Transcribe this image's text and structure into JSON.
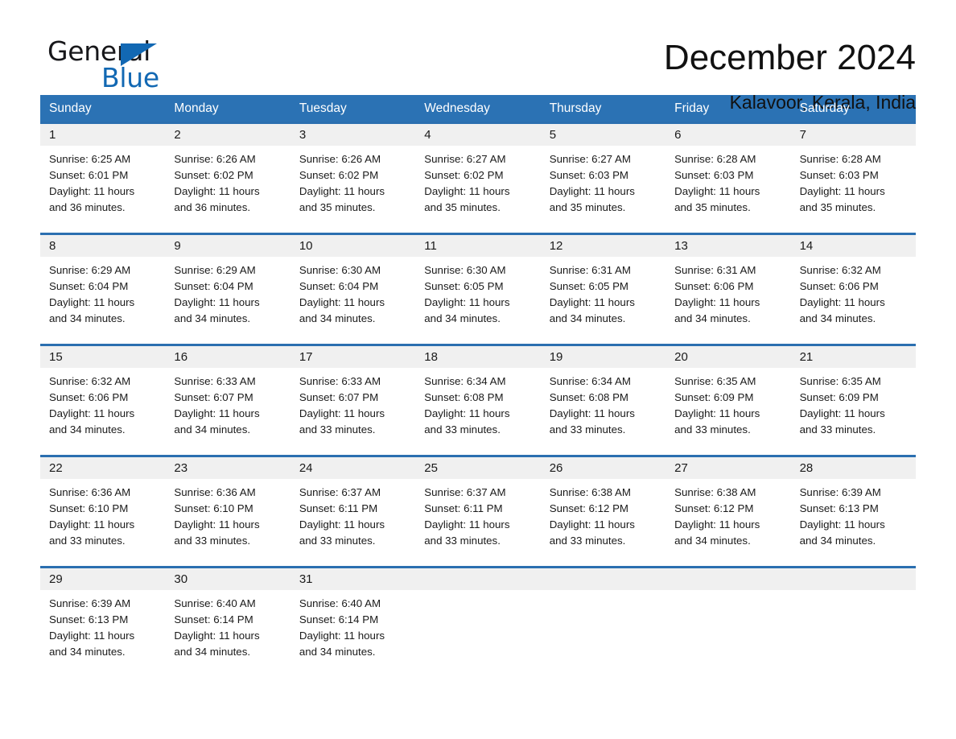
{
  "brand": {
    "name_part1": "General",
    "name_part2": "Blue",
    "accent_color": "#1268b3"
  },
  "header": {
    "month_title": "December 2024",
    "location": "Kalavoor, Kerala, India"
  },
  "theme": {
    "header_blue": "#2b72b4",
    "separator_blue": "#2b6fb0",
    "daynum_band": "#f0f0f0"
  },
  "calendar": {
    "weekdays": [
      "Sunday",
      "Monday",
      "Tuesday",
      "Wednesday",
      "Thursday",
      "Friday",
      "Saturday"
    ],
    "weeks": [
      {
        "days": [
          {
            "num": "1",
            "sunrise": "Sunrise: 6:25 AM",
            "sunset": "Sunset: 6:01 PM",
            "daylight_l1": "Daylight: 11 hours",
            "daylight_l2": "and 36 minutes."
          },
          {
            "num": "2",
            "sunrise": "Sunrise: 6:26 AM",
            "sunset": "Sunset: 6:02 PM",
            "daylight_l1": "Daylight: 11 hours",
            "daylight_l2": "and 36 minutes."
          },
          {
            "num": "3",
            "sunrise": "Sunrise: 6:26 AM",
            "sunset": "Sunset: 6:02 PM",
            "daylight_l1": "Daylight: 11 hours",
            "daylight_l2": "and 35 minutes."
          },
          {
            "num": "4",
            "sunrise": "Sunrise: 6:27 AM",
            "sunset": "Sunset: 6:02 PM",
            "daylight_l1": "Daylight: 11 hours",
            "daylight_l2": "and 35 minutes."
          },
          {
            "num": "5",
            "sunrise": "Sunrise: 6:27 AM",
            "sunset": "Sunset: 6:03 PM",
            "daylight_l1": "Daylight: 11 hours",
            "daylight_l2": "and 35 minutes."
          },
          {
            "num": "6",
            "sunrise": "Sunrise: 6:28 AM",
            "sunset": "Sunset: 6:03 PM",
            "daylight_l1": "Daylight: 11 hours",
            "daylight_l2": "and 35 minutes."
          },
          {
            "num": "7",
            "sunrise": "Sunrise: 6:28 AM",
            "sunset": "Sunset: 6:03 PM",
            "daylight_l1": "Daylight: 11 hours",
            "daylight_l2": "and 35 minutes."
          }
        ]
      },
      {
        "days": [
          {
            "num": "8",
            "sunrise": "Sunrise: 6:29 AM",
            "sunset": "Sunset: 6:04 PM",
            "daylight_l1": "Daylight: 11 hours",
            "daylight_l2": "and 34 minutes."
          },
          {
            "num": "9",
            "sunrise": "Sunrise: 6:29 AM",
            "sunset": "Sunset: 6:04 PM",
            "daylight_l1": "Daylight: 11 hours",
            "daylight_l2": "and 34 minutes."
          },
          {
            "num": "10",
            "sunrise": "Sunrise: 6:30 AM",
            "sunset": "Sunset: 6:04 PM",
            "daylight_l1": "Daylight: 11 hours",
            "daylight_l2": "and 34 minutes."
          },
          {
            "num": "11",
            "sunrise": "Sunrise: 6:30 AM",
            "sunset": "Sunset: 6:05 PM",
            "daylight_l1": "Daylight: 11 hours",
            "daylight_l2": "and 34 minutes."
          },
          {
            "num": "12",
            "sunrise": "Sunrise: 6:31 AM",
            "sunset": "Sunset: 6:05 PM",
            "daylight_l1": "Daylight: 11 hours",
            "daylight_l2": "and 34 minutes."
          },
          {
            "num": "13",
            "sunrise": "Sunrise: 6:31 AM",
            "sunset": "Sunset: 6:06 PM",
            "daylight_l1": "Daylight: 11 hours",
            "daylight_l2": "and 34 minutes."
          },
          {
            "num": "14",
            "sunrise": "Sunrise: 6:32 AM",
            "sunset": "Sunset: 6:06 PM",
            "daylight_l1": "Daylight: 11 hours",
            "daylight_l2": "and 34 minutes."
          }
        ]
      },
      {
        "days": [
          {
            "num": "15",
            "sunrise": "Sunrise: 6:32 AM",
            "sunset": "Sunset: 6:06 PM",
            "daylight_l1": "Daylight: 11 hours",
            "daylight_l2": "and 34 minutes."
          },
          {
            "num": "16",
            "sunrise": "Sunrise: 6:33 AM",
            "sunset": "Sunset: 6:07 PM",
            "daylight_l1": "Daylight: 11 hours",
            "daylight_l2": "and 34 minutes."
          },
          {
            "num": "17",
            "sunrise": "Sunrise: 6:33 AM",
            "sunset": "Sunset: 6:07 PM",
            "daylight_l1": "Daylight: 11 hours",
            "daylight_l2": "and 33 minutes."
          },
          {
            "num": "18",
            "sunrise": "Sunrise: 6:34 AM",
            "sunset": "Sunset: 6:08 PM",
            "daylight_l1": "Daylight: 11 hours",
            "daylight_l2": "and 33 minutes."
          },
          {
            "num": "19",
            "sunrise": "Sunrise: 6:34 AM",
            "sunset": "Sunset: 6:08 PM",
            "daylight_l1": "Daylight: 11 hours",
            "daylight_l2": "and 33 minutes."
          },
          {
            "num": "20",
            "sunrise": "Sunrise: 6:35 AM",
            "sunset": "Sunset: 6:09 PM",
            "daylight_l1": "Daylight: 11 hours",
            "daylight_l2": "and 33 minutes."
          },
          {
            "num": "21",
            "sunrise": "Sunrise: 6:35 AM",
            "sunset": "Sunset: 6:09 PM",
            "daylight_l1": "Daylight: 11 hours",
            "daylight_l2": "and 33 minutes."
          }
        ]
      },
      {
        "days": [
          {
            "num": "22",
            "sunrise": "Sunrise: 6:36 AM",
            "sunset": "Sunset: 6:10 PM",
            "daylight_l1": "Daylight: 11 hours",
            "daylight_l2": "and 33 minutes."
          },
          {
            "num": "23",
            "sunrise": "Sunrise: 6:36 AM",
            "sunset": "Sunset: 6:10 PM",
            "daylight_l1": "Daylight: 11 hours",
            "daylight_l2": "and 33 minutes."
          },
          {
            "num": "24",
            "sunrise": "Sunrise: 6:37 AM",
            "sunset": "Sunset: 6:11 PM",
            "daylight_l1": "Daylight: 11 hours",
            "daylight_l2": "and 33 minutes."
          },
          {
            "num": "25",
            "sunrise": "Sunrise: 6:37 AM",
            "sunset": "Sunset: 6:11 PM",
            "daylight_l1": "Daylight: 11 hours",
            "daylight_l2": "and 33 minutes."
          },
          {
            "num": "26",
            "sunrise": "Sunrise: 6:38 AM",
            "sunset": "Sunset: 6:12 PM",
            "daylight_l1": "Daylight: 11 hours",
            "daylight_l2": "and 33 minutes."
          },
          {
            "num": "27",
            "sunrise": "Sunrise: 6:38 AM",
            "sunset": "Sunset: 6:12 PM",
            "daylight_l1": "Daylight: 11 hours",
            "daylight_l2": "and 34 minutes."
          },
          {
            "num": "28",
            "sunrise": "Sunrise: 6:39 AM",
            "sunset": "Sunset: 6:13 PM",
            "daylight_l1": "Daylight: 11 hours",
            "daylight_l2": "and 34 minutes."
          }
        ]
      },
      {
        "days": [
          {
            "num": "29",
            "sunrise": "Sunrise: 6:39 AM",
            "sunset": "Sunset: 6:13 PM",
            "daylight_l1": "Daylight: 11 hours",
            "daylight_l2": "and 34 minutes."
          },
          {
            "num": "30",
            "sunrise": "Sunrise: 6:40 AM",
            "sunset": "Sunset: 6:14 PM",
            "daylight_l1": "Daylight: 11 hours",
            "daylight_l2": "and 34 minutes."
          },
          {
            "num": "31",
            "sunrise": "Sunrise: 6:40 AM",
            "sunset": "Sunset: 6:14 PM",
            "daylight_l1": "Daylight: 11 hours",
            "daylight_l2": "and 34 minutes."
          },
          {
            "num": "",
            "sunrise": "",
            "sunset": "",
            "daylight_l1": "",
            "daylight_l2": ""
          },
          {
            "num": "",
            "sunrise": "",
            "sunset": "",
            "daylight_l1": "",
            "daylight_l2": ""
          },
          {
            "num": "",
            "sunrise": "",
            "sunset": "",
            "daylight_l1": "",
            "daylight_l2": ""
          },
          {
            "num": "",
            "sunrise": "",
            "sunset": "",
            "daylight_l1": "",
            "daylight_l2": ""
          }
        ]
      }
    ]
  }
}
